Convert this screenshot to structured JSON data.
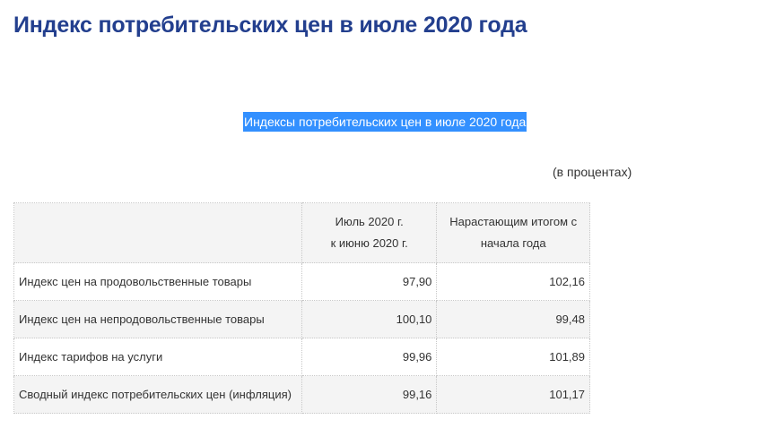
{
  "page": {
    "title": "Индекс потребительских цен в июле 2020 года"
  },
  "caption": "Индексы потребительских цен в июле 2020 года",
  "units_note": "(в процентах)",
  "table": {
    "headers": {
      "label": "",
      "col1_line1": "Июль 2020 г.",
      "col1_line2": "к июню 2020 г.",
      "col2_line1": "Нарастающим итогом с",
      "col2_line2": "начала года"
    },
    "rows": [
      {
        "label": "Индекс цен на продовольственные товары",
        "month": "97,90",
        "ytd": "102,16"
      },
      {
        "label": "Индекс цен на непродовольственные товары",
        "month": "100,10",
        "ytd": "99,48"
      },
      {
        "label": "Индекс тарифов на услуги",
        "month": "99,96",
        "ytd": "101,89"
      },
      {
        "label": "Сводный индекс потребительских цен (инфляция)",
        "month": "99,16",
        "ytd": "101,17"
      }
    ]
  },
  "colors": {
    "title": "#233f8e",
    "selection": "#3390ff",
    "stripe": "#f4f4f4"
  }
}
